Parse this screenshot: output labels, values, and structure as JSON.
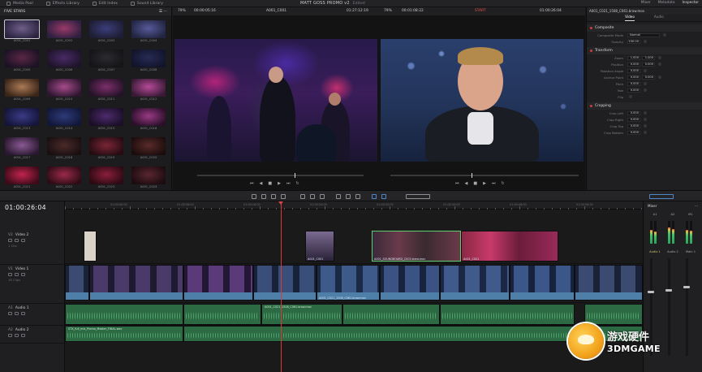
{
  "menubar": {
    "tabs": [
      {
        "label": "Media Pool",
        "icon": "media-pool-icon"
      },
      {
        "label": "Effects Library",
        "icon": "effects-icon"
      },
      {
        "label": "Edit Index",
        "icon": "edit-index-icon"
      },
      {
        "label": "Sound Library",
        "icon": "sound-library-icon"
      }
    ],
    "project_title": "MATT GOSS PROMO v2",
    "project_status": "Edited",
    "right_tabs": [
      "Mixer",
      "Metadata",
      "Inspector"
    ]
  },
  "media_pool": {
    "bin_name": "FIVE STARS",
    "clips": [
      {
        "label": "A001_C001",
        "colors": [
          "#6e5f88",
          "#2b2340"
        ]
      },
      {
        "label": "A001_C002",
        "colors": [
          "#9a3a6a",
          "#2c1f3f"
        ]
      },
      {
        "label": "A001_C003",
        "colors": [
          "#3c3d7a",
          "#1d1d33"
        ]
      },
      {
        "label": "A001_C004",
        "colors": [
          "#565a9a",
          "#222541"
        ]
      },
      {
        "label": "A001_C005",
        "colors": [
          "#5b2747",
          "#1c1224"
        ]
      },
      {
        "label": "A001_C006",
        "colors": [
          "#482a66",
          "#1d1428"
        ]
      },
      {
        "label": "A001_C007",
        "colors": [
          "#2a2a30",
          "#151518"
        ]
      },
      {
        "label": "A001_C008",
        "colors": [
          "#262b55",
          "#12142a"
        ]
      },
      {
        "label": "A001_C009",
        "colors": [
          "#aa7a56",
          "#3a2518"
        ]
      },
      {
        "label": "A001_C010",
        "colors": [
          "#a64b8a",
          "#2e1630"
        ]
      },
      {
        "label": "A001_C011",
        "colors": [
          "#7c2e6b",
          "#241327"
        ]
      },
      {
        "label": "A001_C012",
        "colors": [
          "#b54a97",
          "#381a35"
        ]
      },
      {
        "label": "A001_C013",
        "colors": [
          "#3a3a86",
          "#15153a"
        ]
      },
      {
        "label": "A001_C014",
        "colors": [
          "#2e3a7a",
          "#121738"
        ]
      },
      {
        "label": "A001_C015",
        "colors": [
          "#4d2a6d",
          "#1a0f26"
        ]
      },
      {
        "label": "A001_C016",
        "colors": [
          "#9a3a84",
          "#2a0f2a"
        ]
      },
      {
        "label": "A001_C017",
        "colors": [
          "#8a5a94",
          "#2a1830"
        ]
      },
      {
        "label": "A001_C018",
        "colors": [
          "#4a2a2a",
          "#1a0f10"
        ]
      },
      {
        "label": "A001_C019",
        "colors": [
          "#7a2636",
          "#260c12"
        ]
      },
      {
        "label": "A001_C020",
        "colors": [
          "#5a2a2a",
          "#1c0d0d"
        ]
      },
      {
        "label": "A001_C021",
        "colors": [
          "#c2244e",
          "#3c0b18"
        ]
      },
      {
        "label": "A001_C022",
        "colors": [
          "#9b2a4a",
          "#2c0c16"
        ]
      },
      {
        "label": "A001_C023",
        "colors": [
          "#8a1f3a",
          "#2b0a13"
        ]
      },
      {
        "label": "A001_C024",
        "colors": [
          "#5a2630",
          "#1c0c10"
        ]
      }
    ]
  },
  "source_viewer": {
    "zoom": "79%",
    "timecode": "00:00:05:16",
    "clip_name": "A001_C001",
    "duration": "01:27:12:19"
  },
  "timeline_viewer": {
    "zoom": "79%",
    "timecode": "00:01:08:22",
    "clip_name": "MATT GOSS PROMO v2",
    "marker": "START",
    "duration": "01:00:26:04"
  },
  "inspector": {
    "file_name": "A001_C021_1508_C061.braw.mov",
    "tabs": [
      "Video",
      "Audio"
    ],
    "sections": [
      {
        "title": "Composite",
        "rows": [
          {
            "label": "Composite Mode",
            "value": "Normal"
          },
          {
            "label": "Opacity",
            "value": "100.00"
          }
        ]
      },
      {
        "title": "Transform",
        "rows": [
          {
            "label": "Zoom",
            "x": "1.000",
            "y": "1.000"
          },
          {
            "label": "Position",
            "x": "0.000",
            "y": "0.000"
          },
          {
            "label": "Rotation Angle",
            "x": "0.000",
            "y": ""
          },
          {
            "label": "Anchor Point",
            "x": "0.000",
            "y": "0.000"
          },
          {
            "label": "Pitch",
            "x": "0.000",
            "y": ""
          },
          {
            "label": "Yaw",
            "x": "0.000",
            "y": ""
          },
          {
            "label": "Flip",
            "x": "",
            "y": ""
          }
        ]
      },
      {
        "title": "Cropping",
        "rows": [
          {
            "label": "Crop Left",
            "x": "0.000",
            "y": ""
          },
          {
            "label": "Crop Right",
            "x": "0.000",
            "y": ""
          },
          {
            "label": "Crop Top",
            "x": "0.000",
            "y": ""
          },
          {
            "label": "Crop Bottom",
            "x": "0.000",
            "y": ""
          }
        ]
      }
    ]
  },
  "timeline": {
    "timecode": "01:00:26:04",
    "ruler_labels": [
      "01:00:00:00",
      "01:00:08:00",
      "01:00:16:00",
      "01:00:24:00",
      "01:00:32:00",
      "01:00:40:00",
      "01:00:48:00",
      "01:00:56:00",
      "01:01:04:00"
    ],
    "tracks": [
      {
        "id": "V2",
        "name": "Video 2",
        "sub": "1 Clip"
      },
      {
        "id": "V1",
        "name": "Video 1",
        "sub": "16 Clips"
      },
      {
        "id": "A1",
        "name": "Audio 1",
        "sub": "2.0"
      },
      {
        "id": "A2",
        "name": "Audio 2",
        "sub": "2.0"
      }
    ],
    "video2_clips": [
      {
        "label": "A001_C001"
      },
      {
        "label": "A001_SOUNDBOARD_C003.braw.mov"
      },
      {
        "label": "A001_C021"
      }
    ],
    "video1_clip_label": "A001_C021_1508_C061.braw.mov",
    "audio1_clip_label": "A001_C021_1508_C061.braw.mov",
    "audio2_clip_label": "STX_full_mix_Promo_Master_FINAL.wav"
  },
  "mixer": {
    "title": "Mixer",
    "channels": [
      "A1",
      "A2",
      "M1"
    ],
    "buses": [
      "Audio 1",
      "Audio 2",
      "Main 1"
    ]
  },
  "watermark": {
    "cn": "游戏硬件",
    "en": "3DMGAME"
  },
  "colors": {
    "accent": "#d63a3a",
    "video_clip": "#4d7fa8",
    "audio_clip": "#2b6a43",
    "audio_wave": "#62b97f"
  }
}
